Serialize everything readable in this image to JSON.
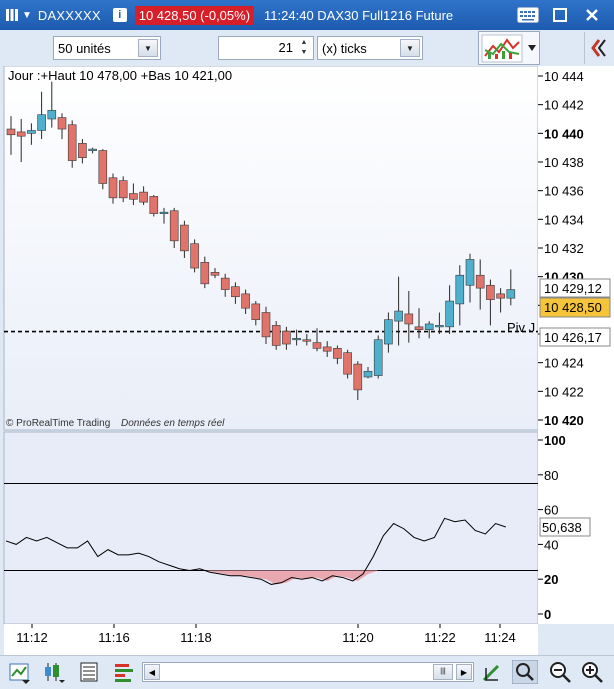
{
  "title_bar": {
    "symbol": "DAXXXXX",
    "info_icon": "info-icon",
    "quote": "10 428,50 (-0,05%)",
    "description": "11:24:40 DAX30 Full1216 Future",
    "quote_color": "#d71f2a"
  },
  "toolbar": {
    "units_value": "50 unités",
    "period_value": "21",
    "period_unit": "(x) ticks"
  },
  "price_panel": {
    "header_text": "Jour :+Haut 10 478,00 +Bas 10 421,00",
    "copyright": "© ProRealTime Trading",
    "realtime": "Données en temps réel",
    "y_ticks": [
      "10 444",
      "10 442",
      "10 440",
      "10 438",
      "10 436",
      "10 434",
      "10 432",
      "10 430",
      "10 428",
      "10 426",
      "10 424",
      "10 422",
      "10 420"
    ],
    "bold_ticks": [
      "10 440",
      "10 430",
      "10 420"
    ],
    "price_labels": {
      "high": "10 429,12",
      "last": "10 428,50",
      "pivot": "10 426,17"
    },
    "pivot_label": "Piv J"
  },
  "oscillator_panel": {
    "y_ticks": [
      "100",
      "80",
      "60",
      "40",
      "20",
      "0"
    ],
    "bold_ticks": [
      "100",
      "20",
      "0"
    ],
    "value_label": "50,638"
  },
  "x_axis": {
    "ticks": [
      "11:12",
      "11:16",
      "11:18",
      "11:20",
      "11:22",
      "11:24"
    ]
  },
  "chart_data": {
    "type": "candlestick",
    "up_color": "#4fb0ce",
    "down_color": "#e0736a",
    "ylim": [
      10420,
      10445
    ],
    "candles": [
      {
        "o": 10440.3,
        "h": 10441.2,
        "l": 10438.5,
        "c": 10439.9
      },
      {
        "o": 10440.1,
        "h": 10441.0,
        "l": 10438.0,
        "c": 10439.8
      },
      {
        "o": 10440.0,
        "h": 10440.7,
        "l": 10439.2,
        "c": 10440.2
      },
      {
        "o": 10440.2,
        "h": 10442.9,
        "l": 10439.6,
        "c": 10441.3
      },
      {
        "o": 10441.0,
        "h": 10443.6,
        "l": 10440.4,
        "c": 10441.6
      },
      {
        "o": 10441.1,
        "h": 10441.4,
        "l": 10439.6,
        "c": 10440.3
      },
      {
        "o": 10440.6,
        "h": 10440.9,
        "l": 10437.6,
        "c": 10438.1
      },
      {
        "o": 10439.3,
        "h": 10439.6,
        "l": 10437.9,
        "c": 10438.3
      },
      {
        "o": 10438.8,
        "h": 10439.0,
        "l": 10438.6,
        "c": 10438.9
      },
      {
        "o": 10438.8,
        "h": 10438.9,
        "l": 10436.1,
        "c": 10436.5
      },
      {
        "o": 10436.9,
        "h": 10437.2,
        "l": 10435.1,
        "c": 10435.5
      },
      {
        "o": 10436.7,
        "h": 10437.0,
        "l": 10435.2,
        "c": 10435.5
      },
      {
        "o": 10435.8,
        "h": 10436.5,
        "l": 10435.0,
        "c": 10435.4
      },
      {
        "o": 10435.9,
        "h": 10436.3,
        "l": 10435.0,
        "c": 10435.2
      },
      {
        "o": 10435.6,
        "h": 10435.7,
        "l": 10434.2,
        "c": 10434.4
      },
      {
        "o": 10434.5,
        "h": 10434.8,
        "l": 10433.7,
        "c": 10434.5
      },
      {
        "o": 10434.6,
        "h": 10434.8,
        "l": 10432.0,
        "c": 10432.5
      },
      {
        "o": 10433.6,
        "h": 10433.9,
        "l": 10431.3,
        "c": 10431.8
      },
      {
        "o": 10432.3,
        "h": 10432.6,
        "l": 10430.3,
        "c": 10430.6
      },
      {
        "o": 10431.0,
        "h": 10431.4,
        "l": 10429.2,
        "c": 10429.5
      },
      {
        "o": 10430.3,
        "h": 10430.6,
        "l": 10429.9,
        "c": 10430.1
      },
      {
        "o": 10429.9,
        "h": 10430.2,
        "l": 10428.6,
        "c": 10429.1
      },
      {
        "o": 10429.3,
        "h": 10429.6,
        "l": 10428.1,
        "c": 10428.6
      },
      {
        "o": 10428.8,
        "h": 10429.1,
        "l": 10427.4,
        "c": 10427.8
      },
      {
        "o": 10428.1,
        "h": 10428.3,
        "l": 10426.6,
        "c": 10427.0
      },
      {
        "o": 10427.5,
        "h": 10427.9,
        "l": 10425.3,
        "c": 10425.8
      },
      {
        "o": 10426.6,
        "h": 10426.9,
        "l": 10424.9,
        "c": 10425.2
      },
      {
        "o": 10426.2,
        "h": 10426.5,
        "l": 10424.9,
        "c": 10425.3
      },
      {
        "o": 10425.6,
        "h": 10426.3,
        "l": 10425.2,
        "c": 10425.7
      },
      {
        "o": 10425.6,
        "h": 10426.0,
        "l": 10425.2,
        "c": 10425.5
      },
      {
        "o": 10425.4,
        "h": 10426.4,
        "l": 10424.8,
        "c": 10425.0
      },
      {
        "o": 10425.1,
        "h": 10425.5,
        "l": 10424.4,
        "c": 10424.8
      },
      {
        "o": 10425.0,
        "h": 10425.2,
        "l": 10423.9,
        "c": 10424.3
      },
      {
        "o": 10424.7,
        "h": 10424.9,
        "l": 10422.9,
        "c": 10423.2
      },
      {
        "o": 10423.9,
        "h": 10424.1,
        "l": 10421.4,
        "c": 10422.1
      },
      {
        "o": 10423.0,
        "h": 10423.7,
        "l": 10422.9,
        "c": 10423.4
      },
      {
        "o": 10423.1,
        "h": 10425.9,
        "l": 10422.9,
        "c": 10425.6
      },
      {
        "o": 10425.3,
        "h": 10427.5,
        "l": 10424.7,
        "c": 10427.0
      },
      {
        "o": 10426.9,
        "h": 10430.0,
        "l": 10425.2,
        "c": 10427.6
      },
      {
        "o": 10427.4,
        "h": 10429.0,
        "l": 10425.4,
        "c": 10426.7
      },
      {
        "o": 10426.5,
        "h": 10427.8,
        "l": 10425.7,
        "c": 10426.3
      },
      {
        "o": 10426.3,
        "h": 10426.9,
        "l": 10425.7,
        "c": 10426.7
      },
      {
        "o": 10426.6,
        "h": 10427.5,
        "l": 10426.0,
        "c": 10426.6
      },
      {
        "o": 10426.5,
        "h": 10429.4,
        "l": 10426.0,
        "c": 10428.3
      },
      {
        "o": 10428.1,
        "h": 10430.8,
        "l": 10426.6,
        "c": 10430.1
      },
      {
        "o": 10429.4,
        "h": 10431.6,
        "l": 10428.2,
        "c": 10431.2
      },
      {
        "o": 10430.1,
        "h": 10431.2,
        "l": 10427.7,
        "c": 10429.2
      },
      {
        "o": 10429.4,
        "h": 10429.8,
        "l": 10426.6,
        "c": 10428.4
      },
      {
        "o": 10428.8,
        "h": 10429.2,
        "l": 10427.5,
        "c": 10428.5
      },
      {
        "o": 10428.5,
        "h": 10430.5,
        "l": 10428.0,
        "c": 10429.1
      }
    ],
    "pivot": 10426.17,
    "oscillator": {
      "ylim": [
        -5,
        105
      ],
      "levels": [
        75,
        25
      ],
      "values": [
        42,
        40,
        44,
        42,
        44,
        41,
        38,
        38,
        42,
        33,
        37,
        34,
        34,
        35,
        33,
        30,
        28,
        26,
        25,
        26,
        24,
        23,
        22,
        22,
        21,
        20,
        17,
        18,
        21,
        20,
        21,
        19,
        22,
        21,
        19,
        23,
        33,
        45,
        52,
        49,
        44,
        42,
        44,
        55,
        53,
        54,
        48,
        46,
        52,
        50
      ]
    }
  }
}
